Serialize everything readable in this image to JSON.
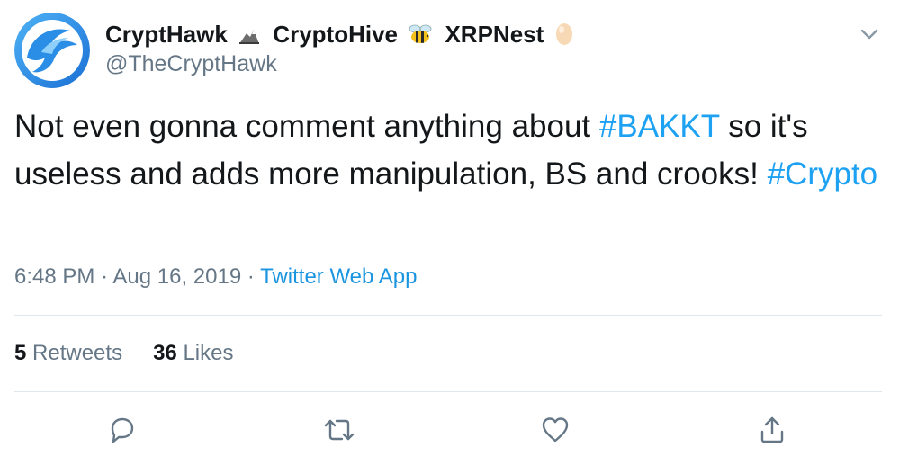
{
  "tweet": {
    "display_names": [
      "CryptHawk",
      "CryptoHive",
      "XRPNest"
    ],
    "handle": "@TheCryptHawk",
    "text_parts": [
      {
        "text": "Not even gonna comment anything about ",
        "hashtag": false
      },
      {
        "text": "#BAKKT",
        "hashtag": true
      },
      {
        "text": " so it's useless and adds more manipulation, BS and crooks! ",
        "hashtag": false
      },
      {
        "text": "#Crypto",
        "hashtag": true
      }
    ],
    "time": "6:48 PM",
    "date": "Aug 16, 2019",
    "separator": "·",
    "source": "Twitter Web App",
    "retweet_count": "5",
    "retweet_label": "Retweets",
    "like_count": "36",
    "like_label": "Likes"
  },
  "icons": {
    "menu": "chevron-down-icon",
    "reply": "reply-icon",
    "retweet": "retweet-icon",
    "like": "heart-icon",
    "share": "share-icon",
    "emoji_1": "eagle-emoji",
    "emoji_2": "bee-emoji",
    "emoji_3": "egg-emoji"
  },
  "colors": {
    "link": "#1da1f2",
    "secondary_text": "#657786",
    "primary_text": "#14171a",
    "divider": "#e1e8ed"
  }
}
